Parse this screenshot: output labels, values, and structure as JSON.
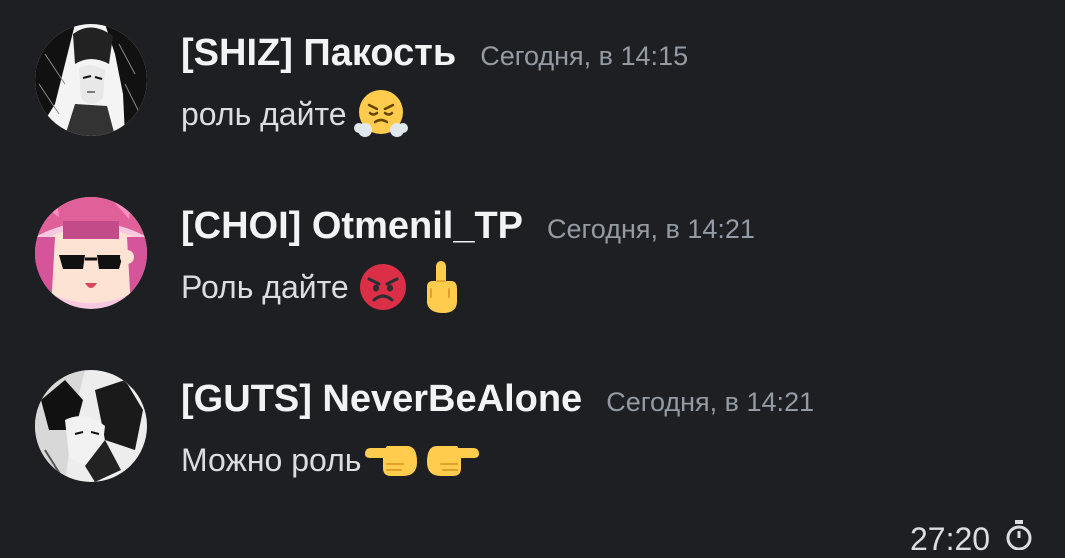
{
  "messages": [
    {
      "username": "[SHIZ] Пакость",
      "timestamp": "Сегодня, в 14:15",
      "text": "роль дайте",
      "emojis": [
        "face-with-steam-emoji"
      ]
    },
    {
      "username": "[CHOI] Otmenil_TP",
      "timestamp": "Сегодня, в 14:21",
      "text": "Роль дайте",
      "emojis": [
        "angry-face-emoji",
        "middle-finger-emoji"
      ]
    },
    {
      "username": "[GUTS] NeverBeAlone",
      "timestamp": "Сегодня, в 14:21",
      "text": "Можно роль",
      "emojis": [
        "pointing-left-emoji",
        "pointing-right-emoji"
      ]
    }
  ],
  "footer": {
    "partial_time": "27:20",
    "icon": "stopwatch-icon"
  },
  "colors": {
    "background": "#1e1f22",
    "username": "#f2f3f5",
    "timestamp": "#949ba4",
    "text": "#dbdee1"
  }
}
